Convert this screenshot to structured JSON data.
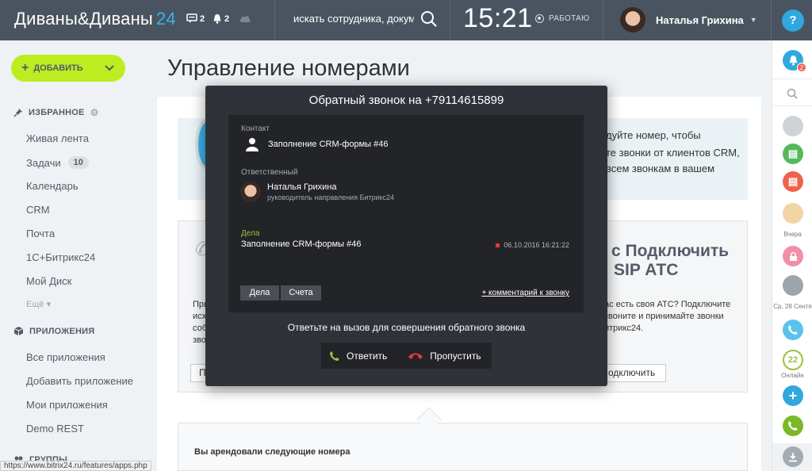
{
  "header": {
    "logo_main": "Диваны&Диваны",
    "logo_num": "24",
    "messages_count": "2",
    "notifications_count": "2",
    "search_placeholder": "искать сотрудника, докуме",
    "time": "15:21",
    "status": "РАБОТАЮ",
    "user_name": "Наталья Грихина",
    "help": "?"
  },
  "sidebar": {
    "add_label": "ДОБАВИТЬ",
    "favorites_title": "ИЗБРАННОЕ",
    "favorites": [
      {
        "label": "Живая лента"
      },
      {
        "label": "Задачи",
        "badge": "10"
      },
      {
        "label": "Календарь"
      },
      {
        "label": "CRM"
      },
      {
        "label": "Почта"
      },
      {
        "label": "1С+Битрикс24"
      },
      {
        "label": "Мой Диск"
      }
    ],
    "more_label": "Ещё",
    "apps_title": "ПРИЛОЖЕНИЯ",
    "apps": [
      {
        "label": "Все приложения"
      },
      {
        "label": "Добавить приложение"
      },
      {
        "label": "Мои приложения"
      },
      {
        "label": "Demo REST"
      }
    ],
    "groups_title": "ГРУППЫ"
  },
  "page": {
    "title": "Управление номерами",
    "banner_lines": [
      "дуйте номер, чтобы",
      "те звонки от клиентов CRM,",
      "всем звонкам в вашем"
    ],
    "panel_head_lines": [
      "Подключить",
      "SIP АТС"
    ],
    "panel_head_prefix": "с",
    "panel_sub_lines": [
      "ас есть своя АТС? Подключите",
      "звоните и принимайте звонки",
      "итрикс24."
    ],
    "panel_button": "одключить",
    "left_text_lines": [
      "При",
      "исх",
      "собс",
      "зво"
    ],
    "left_button": "П",
    "rented_title": "Вы арендовали следующие номера"
  },
  "statusbar": "https://www.bitrix24.ru/features/apps.php",
  "rail": {
    "notif_count": "2",
    "label_yesterday": "Вчера",
    "label_date": "Ср, 28 Сентя",
    "online_count": "22",
    "online_label": "Онлайн"
  },
  "modal": {
    "title": "Обратный звонок на +79114615899",
    "contact_label": "Контакт",
    "contact_name": "Заполнение CRM-формы #46",
    "responsible_label": "Ответственный",
    "responsible_name": "Наталья Грихина",
    "responsible_position": "руководитель направления Битрикс24",
    "deals_label": "Дела",
    "deal_title": "Заполнение CRM-формы #46",
    "deal_date": "06.10.2016 16:21:22",
    "tab_deals": "Дела",
    "tab_invoices": "Счета",
    "comment_link": "+ комментарий к звонку",
    "hint": "Ответьте на вызов для совершения обратного звонка",
    "answer": "Ответить",
    "skip": "Пропустить"
  },
  "colors": {
    "header_bg": "#4a5460",
    "accent_blue": "#39b2e8",
    "add_green": "#bbed21",
    "modal_bg": "#2f3238",
    "answer_green": "#9ac23b",
    "reject_red": "#e23b3b"
  }
}
